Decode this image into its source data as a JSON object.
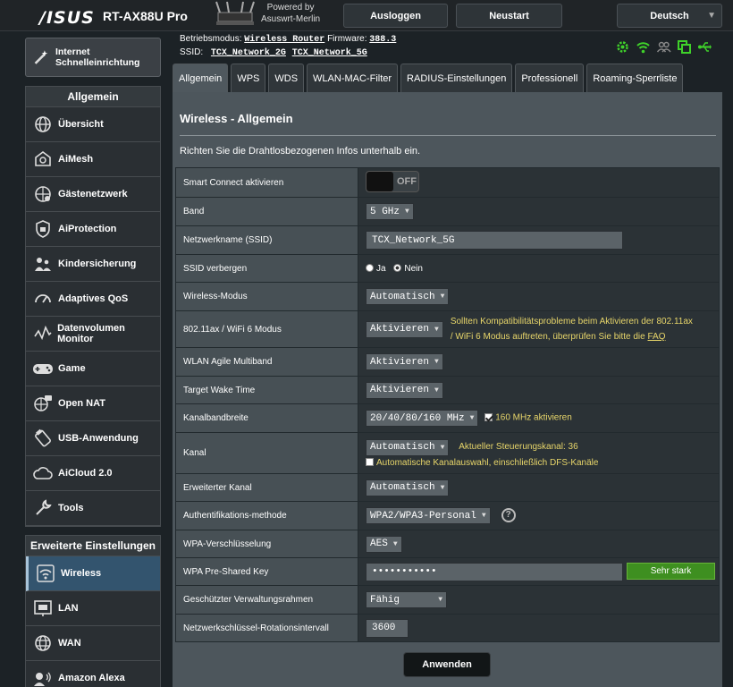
{
  "header": {
    "logo": "/ISUS",
    "model": "RT-AX88U Pro",
    "powered_line1": "Powered by",
    "powered_line2": "Asuswrt-Merlin",
    "logout": "Ausloggen",
    "restart": "Neustart",
    "language": "Deutsch",
    "opmode_label": "Betriebsmodus:",
    "opmode_value": "Wireless Router",
    "firmware_label": "Firmware:",
    "firmware_value": "388.3",
    "ssid_label": "SSID:",
    "ssid_2g": "TCX_Network_2G",
    "ssid_5g": "TCX_Network_5G"
  },
  "sidebar": {
    "qis_label": "Internet Schnelleinrichtung",
    "general_header": "Allgemein",
    "general_items": [
      {
        "label": "Übersicht",
        "icon": "globe-icon"
      },
      {
        "label": "AiMesh",
        "icon": "aimesh-icon"
      },
      {
        "label": "Gästenetzwerk",
        "icon": "guest-network-icon"
      },
      {
        "label": "AiProtection",
        "icon": "shield-icon"
      },
      {
        "label": "Kindersicherung",
        "icon": "parental-icon"
      },
      {
        "label": "Adaptives QoS",
        "icon": "speedometer-icon"
      },
      {
        "label": "Datenvolumen Monitor",
        "icon": "traffic-icon"
      },
      {
        "label": "Game",
        "icon": "gamepad-icon"
      },
      {
        "label": "Open NAT",
        "icon": "open-nat-icon"
      },
      {
        "label": "USB-Anwendung",
        "icon": "usb-icon"
      },
      {
        "label": "AiCloud 2.0",
        "icon": "cloud-icon"
      },
      {
        "label": "Tools",
        "icon": "wrench-icon"
      }
    ],
    "advanced_header": "Erweiterte Einstellungen",
    "advanced_items": [
      {
        "label": "Wireless",
        "icon": "wireless-icon"
      },
      {
        "label": "LAN",
        "icon": "lan-icon"
      },
      {
        "label": "WAN",
        "icon": "wan-globe-icon"
      },
      {
        "label": "Amazon Alexa",
        "icon": "alexa-icon"
      }
    ]
  },
  "tabs": [
    "Allgemein",
    "WPS",
    "WDS",
    "WLAN-MAC-Filter",
    "RADIUS-Einstellungen",
    "Professionell",
    "Roaming-Sperrliste"
  ],
  "panel": {
    "title": "Wireless - Allgemein",
    "description": "Richten Sie die Drahtlosbezogenen Infos unterhalb ein.",
    "rows": {
      "smart_connect": {
        "label": "Smart Connect aktivieren",
        "value": "OFF"
      },
      "band": {
        "label": "Band",
        "value": "5 GHz"
      },
      "ssid": {
        "label": "Netzwerkname (SSID)",
        "value": "TCX_Network_5G"
      },
      "ssid_hide": {
        "label": "SSID verbergen",
        "yes": "Ja",
        "no": "Nein"
      },
      "wireless_mode": {
        "label": "Wireless-Modus",
        "value": "Automatisch"
      },
      "ax_mode": {
        "label": "802.11ax / WiFi 6 Modus",
        "value": "Aktivieren",
        "hint1": "Sollten Kompatibilitätsprobleme beim Aktivieren der 802.11ax",
        "hint2": "/ WiFi 6 Modus auftreten, überprüfen Sie bitte die ",
        "hint_link": "FAQ"
      },
      "agile": {
        "label": "WLAN Agile Multiband",
        "value": "Aktivieren"
      },
      "twt": {
        "label": "Target Wake Time",
        "value": "Aktivieren"
      },
      "bandwidth": {
        "label": "Kanalbandbreite",
        "value": "20/40/80/160 MHz",
        "check": "160 MHz aktivieren"
      },
      "channel": {
        "label": "Kanal",
        "value": "Automatisch",
        "hint": "Aktueller Steuerungskanal: 36",
        "check": "Automatische Kanalauswahl, einschließlich DFS-Kanäle"
      },
      "ext_channel": {
        "label": "Erweiterter Kanal",
        "value": "Automatisch"
      },
      "auth": {
        "label": "Authentifikations-methode",
        "value": "WPA2/WPA3-Personal"
      },
      "wpa_enc": {
        "label": "WPA-Verschlüsselung",
        "value": "AES"
      },
      "psk": {
        "label": "WPA Pre-Shared Key",
        "value": "•••••••••••",
        "strength": "Sehr stark"
      },
      "pmf": {
        "label": "Geschützter Verwaltungsrahmen",
        "value": "Fähig"
      },
      "rotation": {
        "label": "Netzwerkschlüssel-Rotationsintervall",
        "value": "3600"
      }
    },
    "apply": "Anwenden"
  }
}
